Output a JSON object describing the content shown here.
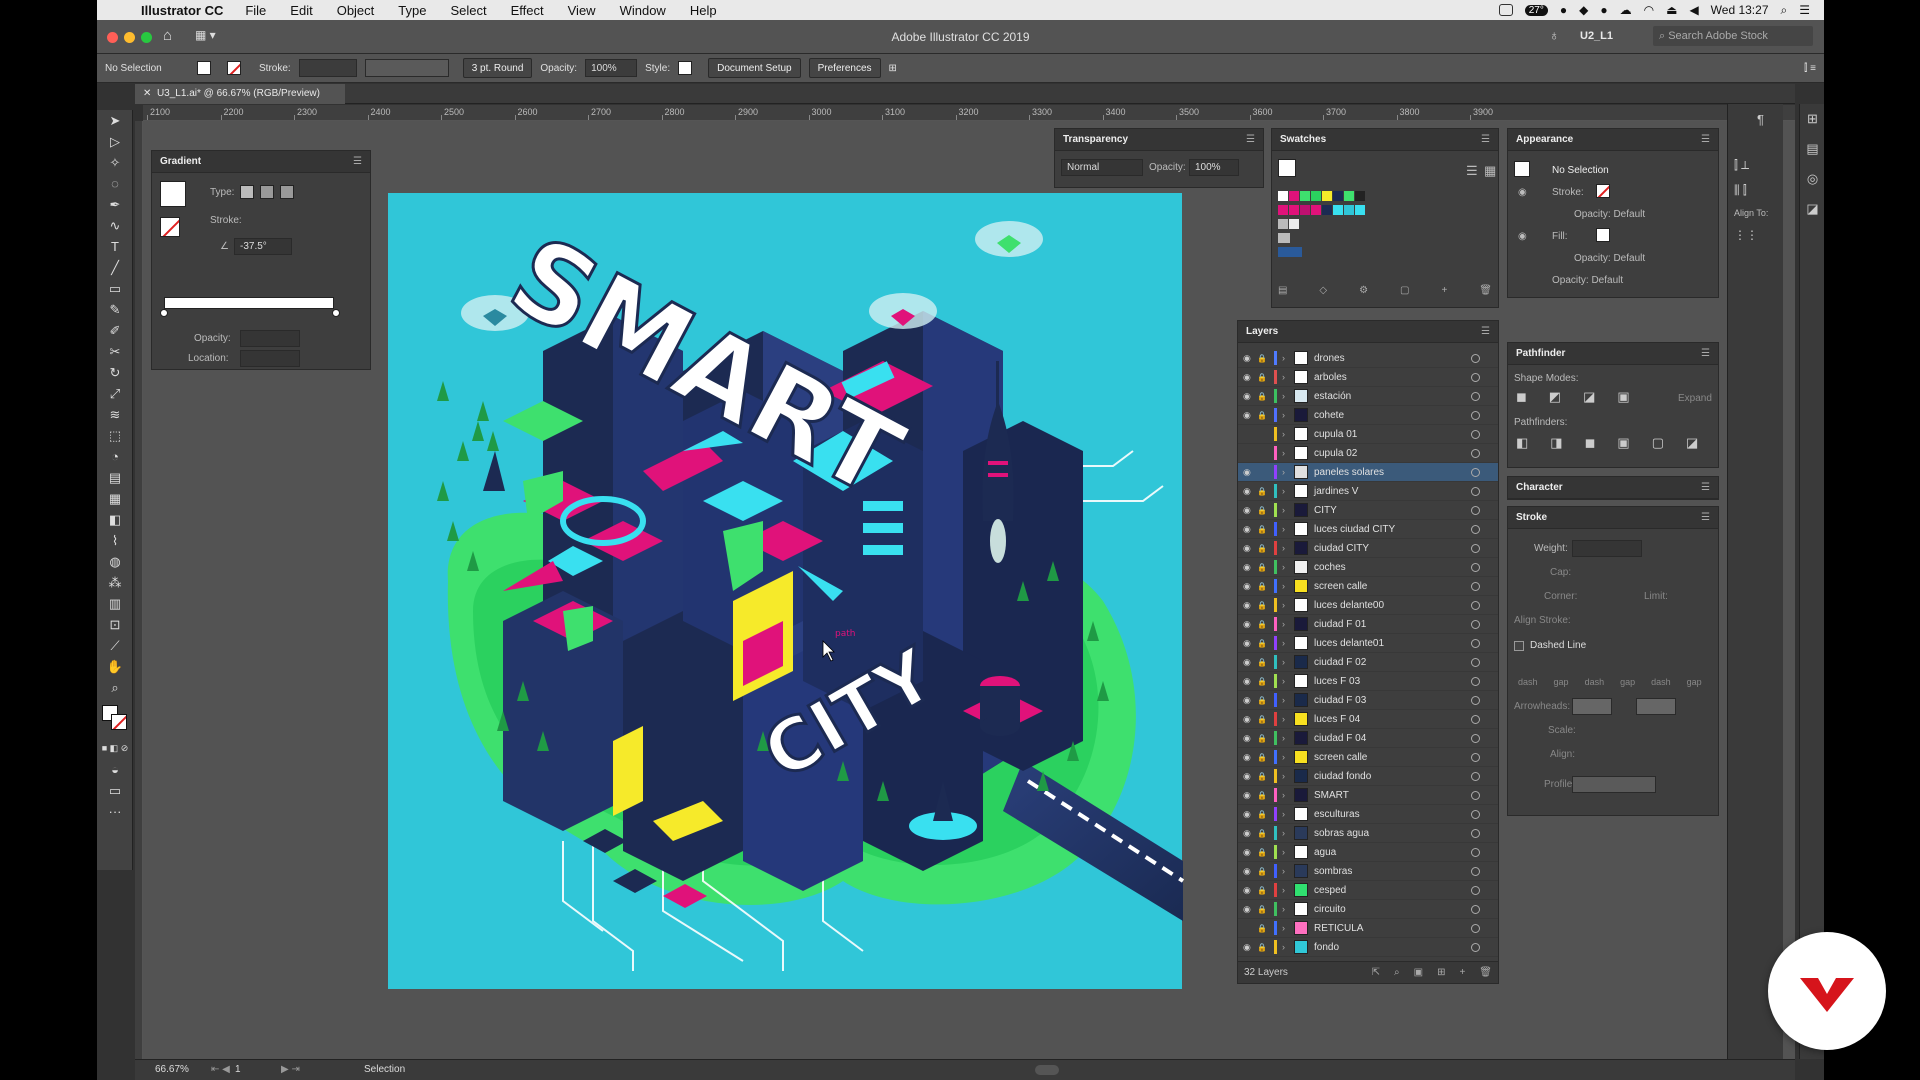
{
  "menubar": {
    "app_name": "Illustrator CC",
    "items": [
      "File",
      "Edit",
      "Object",
      "Type",
      "Select",
      "Effect",
      "View",
      "Window",
      "Help"
    ],
    "temp": "27°",
    "clock": "Wed 13:27"
  },
  "titlebar": {
    "title": "Adobe Illustrator CC 2019",
    "workspace": "U2_L1",
    "search_placeholder": "Search Adobe Stock"
  },
  "control": {
    "selection": "No Selection",
    "stroke_label": "Stroke:",
    "brush": "3 pt. Round",
    "opacity_label": "Opacity:",
    "opacity": "100%",
    "style_label": "Style:",
    "doc_setup": "Document Setup",
    "preferences": "Preferences"
  },
  "document": {
    "tab": "U3_L1.ai* @ 66.67% (RGB/Preview)"
  },
  "ruler": [
    "2100",
    "2200",
    "2300",
    "2400",
    "2500",
    "2600",
    "2700",
    "2800",
    "2900",
    "3000",
    "3100",
    "3200",
    "3300",
    "3400",
    "3500",
    "3600",
    "3700",
    "3800",
    "3900"
  ],
  "gradient": {
    "title": "Gradient",
    "type_label": "Type:",
    "stroke_label": "Stroke:",
    "angle": "-37.5°",
    "opacity_label": "Opacity:",
    "location_label": "Location:"
  },
  "transparency": {
    "title": "Transparency",
    "mode": "Normal",
    "opacity_label": "Opacity:",
    "opacity": "100%"
  },
  "swatches": {
    "title": "Swatches"
  },
  "appearance": {
    "title": "Appearance",
    "selection": "No Selection",
    "stroke_label": "Stroke:",
    "fill_label": "Fill:",
    "opacity_default": "Opacity: Default"
  },
  "pathfinder": {
    "title": "Pathfinder",
    "shape_modes": "Shape Modes:",
    "pathfinders": "Pathfinders:",
    "expand": "Expand"
  },
  "character": {
    "title": "Character"
  },
  "stroke_panel": {
    "title": "Stroke",
    "weight": "Weight:",
    "cap": "Cap:",
    "corner": "Corner:",
    "limit": "Limit:",
    "align_stroke": "Align Stroke:",
    "dashed": "Dashed Line",
    "dash": "dash",
    "gap": "gap",
    "arrowheads": "Arrowheads:",
    "scale": "Scale:",
    "align": "Align:",
    "profile": "Profile:"
  },
  "align_to": "Align To:",
  "layers": {
    "title": "Layers",
    "count": "32 Layers",
    "items": [
      {
        "name": "drones",
        "color": "#4f7bff",
        "thumb": "#ffffff"
      },
      {
        "name": "arboles",
        "color": "#e05050",
        "thumb": "#ffffff"
      },
      {
        "name": "estación",
        "color": "#3cc060",
        "thumb": "#d8e8f0"
      },
      {
        "name": "cohete",
        "color": "#5070ff",
        "thumb": "#1a1a3a"
      },
      {
        "name": "cupula 01",
        "color": "#f0c020",
        "thumb": "#ffffff"
      },
      {
        "name": "cupula 02",
        "color": "#ff60c0",
        "thumb": "#ffffff"
      },
      {
        "name": "paneles solares",
        "color": "#9040ff",
        "thumb": "#e0e0e0"
      },
      {
        "name": "jardines V",
        "color": "#30c0c0",
        "thumb": "#ffffff"
      },
      {
        "name": "CITY",
        "color": "#a0e050",
        "thumb": "#1a1a3a"
      },
      {
        "name": "luces ciudad CITY",
        "color": "#4060ff",
        "thumb": "#ffffff"
      },
      {
        "name": "ciudad CITY",
        "color": "#e04040",
        "thumb": "#1a1a3a"
      },
      {
        "name": "coches",
        "color": "#40c060",
        "thumb": "#f0f0f0"
      },
      {
        "name": "screen calle",
        "color": "#4070ff",
        "thumb": "#f8e020"
      },
      {
        "name": "luces delante00",
        "color": "#f0c020",
        "thumb": "#ffffff"
      },
      {
        "name": "ciudad F 01",
        "color": "#ff60c0",
        "thumb": "#1a1a3a"
      },
      {
        "name": "luces delante01",
        "color": "#9040ff",
        "thumb": "#ffffff"
      },
      {
        "name": "ciudad F 02",
        "color": "#30c0c0",
        "thumb": "#1a2a4a"
      },
      {
        "name": "luces F 03",
        "color": "#a0e050",
        "thumb": "#ffffff"
      },
      {
        "name": "ciudad F 03",
        "color": "#4060ff",
        "thumb": "#1a2a4a"
      },
      {
        "name": "luces F 04",
        "color": "#e04040",
        "thumb": "#f8e020"
      },
      {
        "name": "ciudad F 04",
        "color": "#40c060",
        "thumb": "#1a1a3a"
      },
      {
        "name": "screen calle",
        "color": "#4070ff",
        "thumb": "#f8e020"
      },
      {
        "name": "ciudad fondo",
        "color": "#f0c020",
        "thumb": "#1a2a4a"
      },
      {
        "name": "SMART",
        "color": "#ff60c0",
        "thumb": "#1a1a3a"
      },
      {
        "name": "esculturas",
        "color": "#9040ff",
        "thumb": "#ffffff"
      },
      {
        "name": "sobras agua",
        "color": "#30c0c0",
        "thumb": "#2a3a5a"
      },
      {
        "name": "agua",
        "color": "#a0e050",
        "thumb": "#ffffff"
      },
      {
        "name": "sombras",
        "color": "#4060ff",
        "thumb": "#2a3a5a"
      },
      {
        "name": "cesped",
        "color": "#e04040",
        "thumb": "#30e070"
      },
      {
        "name": "circuito",
        "color": "#40c060",
        "thumb": "#ffffff"
      },
      {
        "name": "RETICULA",
        "color": "#4070ff",
        "thumb": "#ff70c0"
      },
      {
        "name": "fondo",
        "color": "#f0c020",
        "thumb": "#30c8d8"
      }
    ]
  },
  "artwork": {
    "word1": "SMART",
    "word2": "CITY",
    "cursor_tag": "path"
  },
  "status": {
    "zoom": "66.67%",
    "artboard": "1",
    "tool": "Selection"
  },
  "colors": {
    "canvas_bg": "#30c6d8",
    "navy": "#1c2a52",
    "magenta": "#e0127a",
    "green": "#37e86a",
    "yellow": "#f6ea2a",
    "cyan": "#39e0f0"
  }
}
